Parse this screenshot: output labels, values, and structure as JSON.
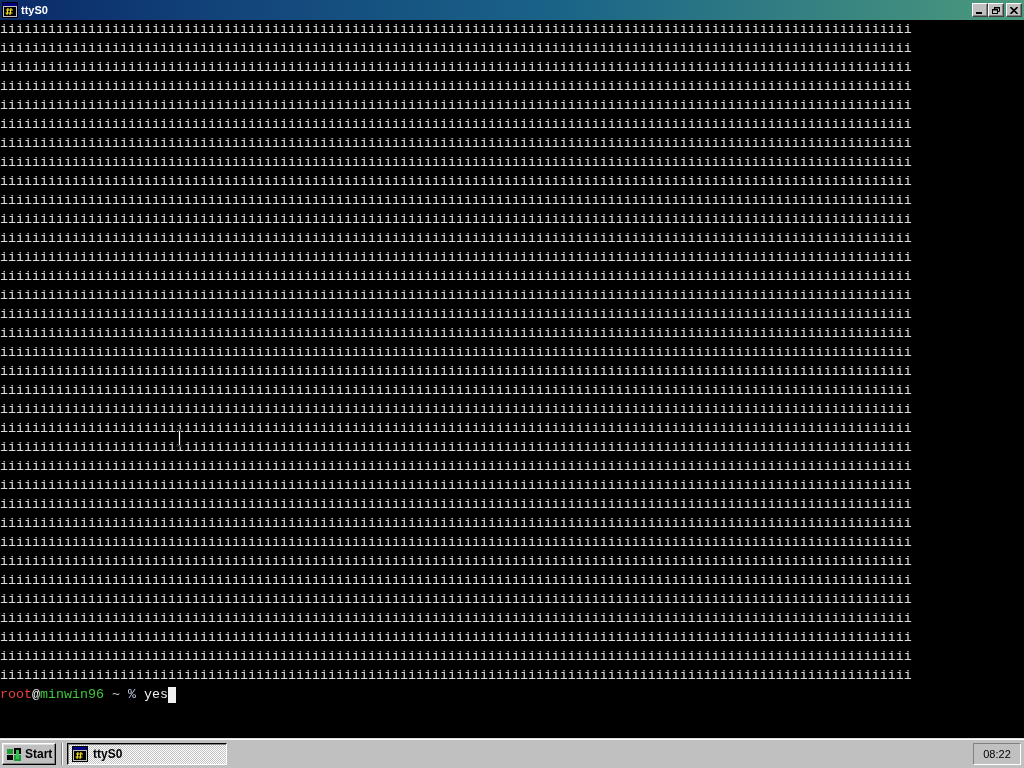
{
  "window": {
    "title": "ttyS0",
    "maximized": true
  },
  "terminal": {
    "lines": [
      "iiiiiiiiiiiiiiiiiiiiiiiiiiiiiiiiiiiiiiiiiiiiiiiiiiiiiiiiiiiiiiiiiiiiiiiiiiiiiiiiiiiiiiiiiiiiiiiiiiiiiiiiiiiiiiiiii",
      "iiiiiiiiiiiiiiiiiiiiiiiiiiiiiiiiiiiiiiiiiiiiiiiiiiiiiiiiiiiiiiiiiiiiiiiiiiiiiiiiiiiiiiiiiiiiiiiiiiiiiiiiiiiiiiiiii",
      "iiiiiiiiiiiiiiiiiiiiiiiiiiiiiiiiiiiiiiiiiiiiiiiiiiiiiiiiiiiiiiiiiiiiiiiiiiiiiiiiiiiiiiiiiiiiiiiiiiiiiiiiiiiiiiiiii",
      "iiiiiiiiiiiiiiiiiiiiiiiiiiiiiiiiiiiiiiiiiiiiiiiiiiiiiiiiiiiiiiiiiiiiiiiiiiiiiiiiiiiiiiiiiiiiiiiiiiiiiiiiiiiiiiiiii",
      "iiiiiiiiiiiiiiiiiiiiiiiiiiiiiiiiiiiiiiiiiiiiiiiiiiiiiiiiiiiiiiiiiiiiiiiiiiiiiiiiiiiiiiiiiiiiiiiiiiiiiiiiiiiiiiiiii",
      "iiiiiiiiiiiiiiiiiiiiiiiiiiiiiiiiiiiiiiiiiiiiiiiiiiiiiiiiiiiiiiiiiiiiiiiiiiiiiiiiiiiiiiiiiiiiiiiiiiiiiiiiiiiiiiiiii",
      "iiiiiiiiiiiiiiiiiiiiiiiiiiiiiiiiiiiiiiiiiiiiiiiiiiiiiiiiiiiiiiiiiiiiiiiiiiiiiiiiiiiiiiiiiiiiiiiiiiiiiiiiiiiiiiiiii",
      "iiiiiiiiiiiiiiiiiiiiiiiiiiiiiiiiiiiiiiiiiiiiiiiiiiiiiiiiiiiiiiiiiiiiiiiiiiiiiiiiiiiiiiiiiiiiiiiiiiiiiiiiiiiiiiiiii",
      "iiiiiiiiiiiiiiiiiiiiiiiiiiiiiiiiiiiiiiiiiiiiiiiiiiiiiiiiiiiiiiiiiiiiiiiiiiiiiiiiiiiiiiiiiiiiiiiiiiiiiiiiiiiiiiiiii",
      "iiiiiiiiiiiiiiiiiiiiiiiiiiiiiiiiiiiiiiiiiiiiiiiiiiiiiiiiiiiiiiiiiiiiiiiiiiiiiiiiiiiiiiiiiiiiiiiiiiiiiiiiiiiiiiiiii",
      "iiiiiiiiiiiiiiiiiiiiiiiiiiiiiiiiiiiiiiiiiiiiiiiiiiiiiiiiiiiiiiiiiiiiiiiiiiiiiiiiiiiiiiiiiiiiiiiiiiiiiiiiiiiiiiiiii",
      "iiiiiiiiiiiiiiiiiiiiiiiiiiiiiiiiiiiiiiiiiiiiiiiiiiiiiiiiiiiiiiiiiiiiiiiiiiiiiiiiiiiiiiiiiiiiiiiiiiiiiiiiiiiiiiiiii",
      "iiiiiiiiiiiiiiiiiiiiiiiiiiiiiiiiiiiiiiiiiiiiiiiiiiiiiiiiiiiiiiiiiiiiiiiiiiiiiiiiiiiiiiiiiiiiiiiiiiiiiiiiiiiiiiiiii",
      "iiiiiiiiiiiiiiiiiiiiiiiiiiiiiiiiiiiiiiiiiiiiiiiiiiiiiiiiiiiiiiiiiiiiiiiiiiiiiiiiiiiiiiiiiiiiiiiiiiiiiiiiiiiiiiiiii",
      "iiiiiiiiiiiiiiiiiiiiiiiiiiiiiiiiiiiiiiiiiiiiiiiiiiiiiiiiiiiiiiiiiiiiiiiiiiiiiiiiiiiiiiiiiiiiiiiiiiiiiiiiiiiiiiiiii",
      "iiiiiiiiiiiiiiiiiiiiiiiiiiiiiiiiiiiiiiiiiiiiiiiiiiiiiiiiiiiiiiiiiiiiiiiiiiiiiiiiiiiiiiiiiiiiiiiiiiiiiiiiiiiiiiiiii",
      "iiiiiiiiiiiiiiiiiiiiiiiiiiiiiiiiiiiiiiiiiiiiiiiiiiiiiiiiiiiiiiiiiiiiiiiiiiiiiiiiiiiiiiiiiiiiiiiiiiiiiiiiiiiiiiiiii",
      "iiiiiiiiiiiiiiiiiiiiiiiiiiiiiiiiiiiiiiiiiiiiiiiiiiiiiiiiiiiiiiiiiiiiiiiiiiiiiiiiiiiiiiiiiiiiiiiiiiiiiiiiiiiiiiiiii",
      "iiiiiiiiiiiiiiiiiiiiiiiiiiiiiiiiiiiiiiiiiiiiiiiiiiiiiiiiiiiiiiiiiiiiiiiiiiiiiiiiiiiiiiiiiiiiiiiiiiiiiiiiiiiiiiiiii",
      "iiiiiiiiiiiiiiiiiiiiiiiiiiiiiiiiiiiiiiiiiiiiiiiiiiiiiiiiiiiiiiiiiiiiiiiiiiiiiiiiiiiiiiiiiiiiiiiiiiiiiiiiiiiiiiiiii",
      "iiiiiiiiiiiiiiiiiiiiiiiiiiiiiiiiiiiiiiiiiiiiiiiiiiiiiiiiiiiiiiiiiiiiiiiiiiiiiiiiiiiiiiiiiiiiiiiiiiiiiiiiiiiiiiiiii",
      "iiiiiiiiiiiiiiiiiiiiiiiiiiiiiiiiiiiiiiiiiiiiiiiiiiiiiiiiiiiiiiiiiiiiiiiiiiiiiiiiiiiiiiiiiiiiiiiiiiiiiiiiiiiiiiiiii",
      "iiiiiiiiiiiiiiiiiiiiiiiiiiiiiiiiiiiiiiiiiiiiiiiiiiiiiiiiiiiiiiiiiiiiiiiiiiiiiiiiiiiiiiiiiiiiiiiiiiiiiiiiiiiiiiiiii",
      "iiiiiiiiiiiiiiiiiiiiiiiiiiiiiiiiiiiiiiiiiiiiiiiiiiiiiiiiiiiiiiiiiiiiiiiiiiiiiiiiiiiiiiiiiiiiiiiiiiiiiiiiiiiiiiiiii",
      "iiiiiiiiiiiiiiiiiiiiiiiiiiiiiiiiiiiiiiiiiiiiiiiiiiiiiiiiiiiiiiiiiiiiiiiiiiiiiiiiiiiiiiiiiiiiiiiiiiiiiiiiiiiiiiiiii",
      "iiiiiiiiiiiiiiiiiiiiiiiiiiiiiiiiiiiiiiiiiiiiiiiiiiiiiiiiiiiiiiiiiiiiiiiiiiiiiiiiiiiiiiiiiiiiiiiiiiiiiiiiiiiiiiiiii",
      "iiiiiiiiiiiiiiiiiiiiiiiiiiiiiiiiiiiiiiiiiiiiiiiiiiiiiiiiiiiiiiiiiiiiiiiiiiiiiiiiiiiiiiiiiiiiiiiiiiiiiiiiiiiiiiiiii",
      "iiiiiiiiiiiiiiiiiiiiiiiiiiiiiiiiiiiiiiiiiiiiiiiiiiiiiiiiiiiiiiiiiiiiiiiiiiiiiiiiiiiiiiiiiiiiiiiiiiiiiiiiiiiiiiiiii",
      "iiiiiiiiiiiiiiiiiiiiiiiiiiiiiiiiiiiiiiiiiiiiiiiiiiiiiiiiiiiiiiiiiiiiiiiiiiiiiiiiiiiiiiiiiiiiiiiiiiiiiiiiiiiiiiiiii",
      "iiiiiiiiiiiiiiiiiiiiiiiiiiiiiiiiiiiiiiiiiiiiiiiiiiiiiiiiiiiiiiiiiiiiiiiiiiiiiiiiiiiiiiiiiiiiiiiiiiiiiiiiiiiiiiiiii",
      "iiiiiiiiiiiiiiiiiiiiiiiiiiiiiiiiiiiiiiiiiiiiiiiiiiiiiiiiiiiiiiiiiiiiiiiiiiiiiiiiiiiiiiiiiiiiiiiiiiiiiiiiiiiiiiiiii",
      "iiiiiiiiiiiiiiiiiiiiiiiiiiiiiiiiiiiiiiiiiiiiiiiiiiiiiiiiiiiiiiiiiiiiiiiiiiiiiiiiiiiiiiiiiiiiiiiiiiiiiiiiiiiiiiiiii",
      "iiiiiiiiiiiiiiiiiiiiiiiiiiiiiiiiiiiiiiiiiiiiiiiiiiiiiiiiiiiiiiiiiiiiiiiiiiiiiiiiiiiiiiiiiiiiiiiiiiiiiiiiiiiiiiiiii",
      "iiiiiiiiiiiiiiiiiiiiiiiiiiiiiiiiiiiiiiiiiiiiiiiiiiiiiiiiiiiiiiiiiiiiiiiiiiiiiiiiiiiiiiiiiiiiiiiiiiiiiiiiiiiiiiiiii",
      "iiiiiiiiiiiiiiiiiiiiiiiiiiiiiiiiiiiiiiiiiiiiiiiiiiiiiiiiiiiiiiiiiiiiiiiiiiiiiiiiiiiiiiiiiiiiiiiiiiiiiiiiiiiiiiiiii"
    ],
    "prompt": {
      "user": "root",
      "at": "@",
      "host": "minwin96",
      "path": "~",
      "symbol": "%",
      "command": "yes"
    }
  },
  "taskbar": {
    "start_label": "Start",
    "tasks": [
      {
        "label": "ttyS0",
        "selected": true
      }
    ],
    "clock": "08:22"
  }
}
